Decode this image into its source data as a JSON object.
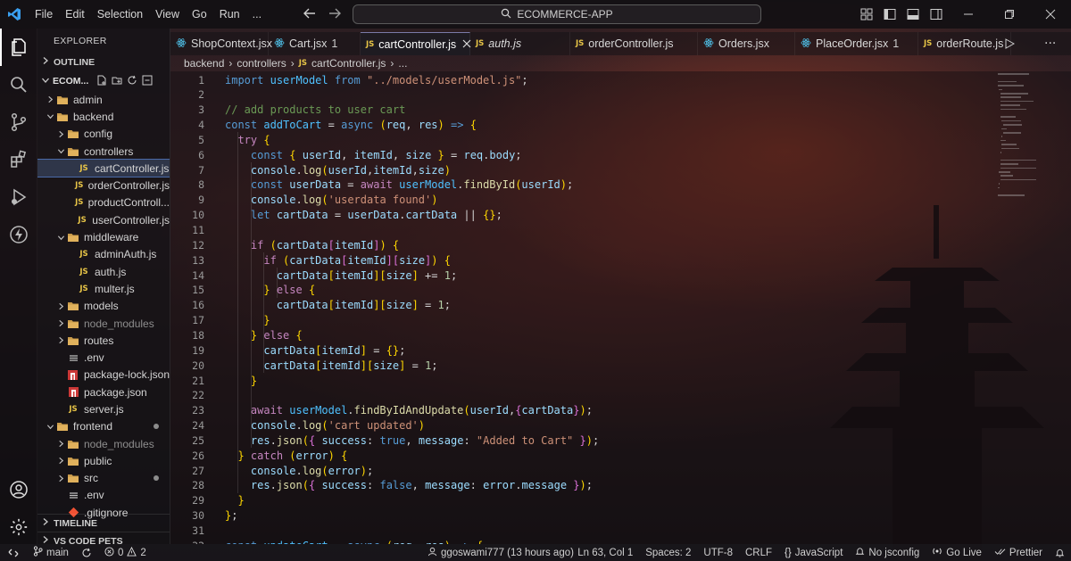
{
  "titlebar": {
    "menu": [
      "File",
      "Edit",
      "Selection",
      "View",
      "Go",
      "Run",
      "..."
    ],
    "command_center": "ECOMMERCE-APP"
  },
  "sidebar": {
    "title": "EXPLORER",
    "outline": "OUTLINE",
    "root": "ECOM...",
    "timeline": "TIMELINE",
    "vscode_pets": "VS CODE PETS",
    "tree": [
      {
        "label": "admin",
        "type": "folder",
        "depth": 1,
        "open": false
      },
      {
        "label": "backend",
        "type": "folder",
        "depth": 1,
        "open": true
      },
      {
        "label": "config",
        "type": "folder",
        "depth": 2,
        "open": false
      },
      {
        "label": "controllers",
        "type": "folder",
        "depth": 2,
        "open": true
      },
      {
        "label": "cartController.js",
        "type": "js",
        "depth": 3,
        "selected": true
      },
      {
        "label": "orderController.js",
        "type": "js",
        "depth": 3
      },
      {
        "label": "productControll...",
        "type": "js",
        "depth": 3
      },
      {
        "label": "userController.js",
        "type": "js",
        "depth": 3
      },
      {
        "label": "middleware",
        "type": "folder",
        "depth": 2,
        "open": true
      },
      {
        "label": "adminAuth.js",
        "type": "js",
        "depth": 3
      },
      {
        "label": "auth.js",
        "type": "js",
        "depth": 3
      },
      {
        "label": "multer.js",
        "type": "js",
        "depth": 3
      },
      {
        "label": "models",
        "type": "folder",
        "depth": 2,
        "open": false
      },
      {
        "label": "node_modules",
        "type": "folder",
        "depth": 2,
        "open": false,
        "dim": true
      },
      {
        "label": "routes",
        "type": "folder",
        "depth": 2,
        "open": false
      },
      {
        "label": ".env",
        "type": "env",
        "depth": 2
      },
      {
        "label": "package-lock.json",
        "type": "npm",
        "depth": 2
      },
      {
        "label": "package.json",
        "type": "npm",
        "depth": 2
      },
      {
        "label": "server.js",
        "type": "js",
        "depth": 2
      },
      {
        "label": "frontend",
        "type": "folder",
        "depth": 1,
        "open": true,
        "dot": true
      },
      {
        "label": "node_modules",
        "type": "folder",
        "depth": 2,
        "open": false,
        "dim": true
      },
      {
        "label": "public",
        "type": "folder",
        "depth": 2,
        "open": false
      },
      {
        "label": "src",
        "type": "folder",
        "depth": 2,
        "open": false,
        "dot": true
      },
      {
        "label": ".env",
        "type": "env",
        "depth": 2
      },
      {
        "label": ".gitignore",
        "type": "git",
        "depth": 2
      }
    ]
  },
  "tabs": [
    {
      "label": "ShopContext.jsx",
      "icon": "react",
      "active": false
    },
    {
      "label": "Cart.jsx",
      "icon": "react",
      "active": false,
      "suffix": "1"
    },
    {
      "label": "cartController.js",
      "icon": "js",
      "active": true
    },
    {
      "label": "auth.js",
      "icon": "js",
      "active": false,
      "italic": true
    },
    {
      "label": "orderController.js",
      "icon": "js",
      "active": false
    },
    {
      "label": "Orders.jsx",
      "icon": "react",
      "active": false
    },
    {
      "label": "PlaceOrder.jsx",
      "icon": "react",
      "active": false,
      "suffix": "1"
    },
    {
      "label": "orderRoute.js",
      "icon": "js",
      "active": false
    }
  ],
  "breadcrumb": [
    "backend",
    "controllers",
    "cartController.js",
    "..."
  ],
  "code_lines": [
    "import userModel from \"../models/userModel.js\";",
    "",
    "// add products to user cart",
    "const addToCart = async (req, res) => {",
    "  try {",
    "    const { userId, itemId, size } = req.body;",
    "    console.log(userId,itemId,size)",
    "    const userData = await userModel.findById(userId);",
    "    console.log('userdata found')",
    "    let cartData = userData.cartData || {};",
    "",
    "    if (cartData[itemId]) {",
    "      if (cartData[itemId][size]) {",
    "        cartData[itemId][size] += 1;",
    "      } else {",
    "        cartData[itemId][size] = 1;",
    "      }",
    "    } else {",
    "      cartData[itemId] = {};",
    "      cartData[itemId][size] = 1;",
    "    }",
    "",
    "    await userModel.findByIdAndUpdate(userId,{cartData});",
    "    console.log('cart updated')",
    "    res.json({ success: true, message: \"Added to Cart\" });",
    "  } catch (error) {",
    "    console.log(error);",
    "    res.json({ success: false, message: error.message });",
    "  }",
    "};",
    "",
    "const updateCart = async (req, res) => {"
  ],
  "statusbar": {
    "branch": "main",
    "errors": "0",
    "warnings": "2",
    "blame": "ggoswami777 (13 hours ago)",
    "position": "Ln 63, Col 1",
    "spaces": "Spaces: 2",
    "encoding": "UTF-8",
    "eol": "CRLF",
    "language": "JavaScript",
    "jsconfig": "No jsconfig",
    "golive": "Go Live",
    "prettier": "Prettier"
  },
  "colors": {
    "keyword": "#569cd6",
    "control": "#c586c0",
    "string": "#ce9178",
    "function": "#dcdcaa",
    "variable": "#9cdcfe",
    "comment": "#6a9955",
    "number": "#b5cea8",
    "js_icon": "#e8c547",
    "react_icon": "#4fc1e9"
  }
}
